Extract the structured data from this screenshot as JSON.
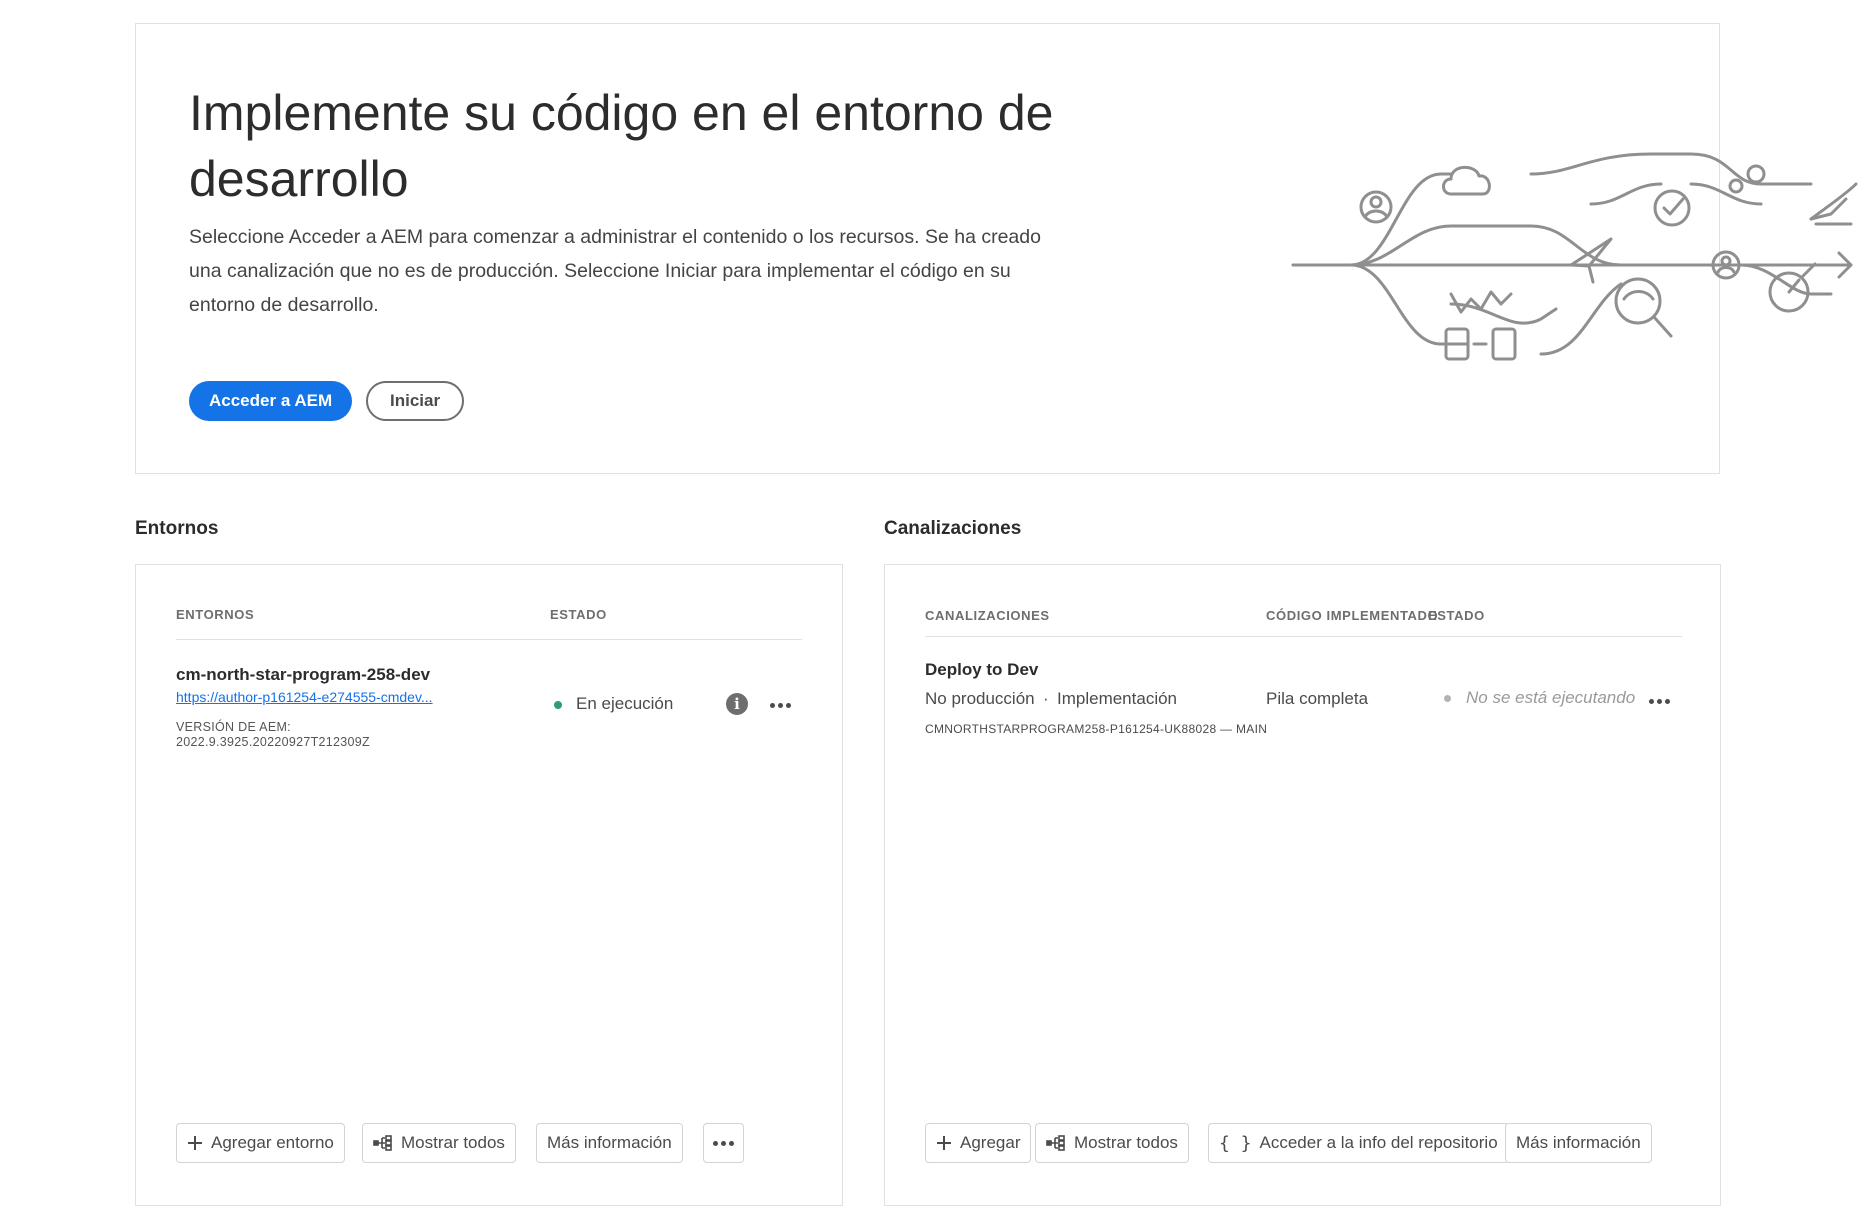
{
  "hero": {
    "title": "Implemente su código en el entorno de desarrollo",
    "description": "Seleccione Acceder a AEM para comenzar a administrar el contenido o los recursos. Se ha creado una canalización que no es de producción. Seleccione Iniciar para implementar el código en su entorno de desarrollo.",
    "primary_button": "Acceder a AEM",
    "secondary_button": "Iniciar"
  },
  "environments": {
    "heading": "Entornos",
    "col_name": "ENTORNOS",
    "col_status": "ESTADO",
    "item": {
      "name": "cm-north-star-program-258-dev",
      "url": "https://author-p161254-e274555-cmdev...",
      "version_label": "VERSIÓN DE AEM:",
      "version": "2022.9.3925.20220927T212309Z",
      "status": "En ejecución",
      "status_color": "#2d9d78"
    },
    "footer": {
      "add": "Agregar entorno",
      "show_all": "Mostrar todos",
      "more_info": "Más información"
    }
  },
  "pipelines": {
    "heading": "Canalizaciones",
    "col_name": "CANALIZACIONES",
    "col_code": "CÓDIGO IMPLEMENTADO",
    "col_status": "ESTADO",
    "item": {
      "name": "Deploy to Dev",
      "type": "No producción",
      "separator": "·",
      "subtype": "Implementación",
      "repo": "CMNORTHSTARPROGRAM258-P161254-UK88028 — MAIN",
      "code": "Pila completa",
      "status": "No se está ejecutando",
      "status_color": "#b3b3b3"
    },
    "footer": {
      "add": "Agregar",
      "show_all": "Mostrar todos",
      "repo_info": "Acceder a la info del repositorio",
      "more_info": "Más información"
    }
  },
  "colors": {
    "accent": "#1473e6",
    "text": "#2c2c2c",
    "muted": "#6e6e6e"
  },
  "icons": [
    "add-icon",
    "hierarchy-icon",
    "code-braces-icon",
    "info-icon",
    "more-icon"
  ]
}
